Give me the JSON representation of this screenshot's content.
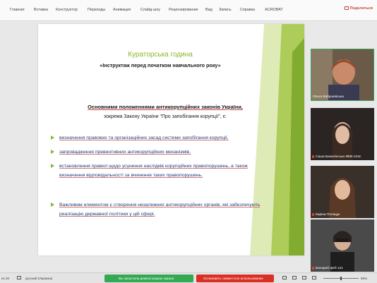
{
  "ribbon": {
    "tabs": [
      "Главная",
      "Вставка",
      "Конструктор",
      "Переходы",
      "Анимация",
      "Слайд-шоу",
      "Рецензирование",
      "Вид",
      "Запись",
      "Справка",
      "ACROBAT"
    ],
    "share_label": "Поделиться"
  },
  "slide": {
    "title": "Кураторська година",
    "subtitle": "«Інструктаж перед початком навчального року»",
    "heading_line1": "Основними положеннями антикорупційних законів України,",
    "heading_line2": "зокрема Закону України “Про запобігання корупції”, є:",
    "bullets": [
      "визначення правових та організаційних засад системи запобігання корупції,",
      "запровадження превентивних антикорупційних механізмів,",
      "встановлення правил щодо усунення наслідків корупційних правопорушень, а також визначення відповідальності за вчинення таких правопорушень.",
      "Важливим елементом є створення незалежних антикорупційних органів, які забезпечують реалізацію державної політики у цій сфері."
    ],
    "accent_color": "#8ab62a",
    "bullet_text_color": "#1f3d7a"
  },
  "participants": [
    {
      "name": "Ольга Кабушевська"
    },
    {
      "name": "Саша Бакалінська ФЕВ-243с"
    },
    {
      "name": "Каріна Поліщук"
    },
    {
      "name": "Басараб феб 121"
    }
  ],
  "status": {
    "slide_counter": "из 20",
    "language": "русский (Украина)",
    "screen_share_text": "Вы запустили демонстрацию экрана",
    "stop_text": "Остановить совместное использование",
    "zoom": "69%"
  }
}
